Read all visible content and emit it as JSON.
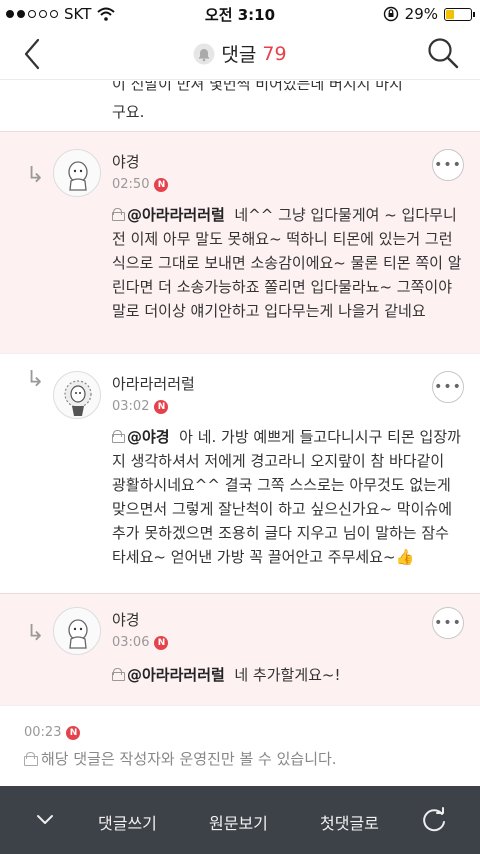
{
  "status_bar": {
    "carrier": "SKT",
    "time": "오전 3:10",
    "battery": "29%",
    "battery_level": 0.29
  },
  "nav": {
    "title": "댓글",
    "count": "79"
  },
  "previous_tail": {
    "line1": "이 신발이 만져 몇번씩 비어있는데 버지지 마지",
    "line2": "구요."
  },
  "comments": [
    {
      "nickname": "야경",
      "time": "02:50",
      "badge": "N",
      "mention": "@아라라러러럴",
      "text": "네^^ 그냥 입다물게여 ~ 입다무니 전 이제 아무 말도 못해요~ 떡하니 티몬에 있는거 그런식으로 그대로 보내면 소송감이에요~ 물론  티몬 쪽이 알린다면 더 소송가능하죠 쫄리면 입다물라뇨~ 그쪽이야 말로 더이상 얘기안하고 입다무는게 나을거 같네요"
    },
    {
      "nickname": "아라라러러럴",
      "time": "03:02",
      "badge": "N",
      "mention": "@야경",
      "text": "아 네. 가방 예쁘게 들고다니시구 티몬 입장까지 생각하셔서 저에게 경고라니 오지랖이 참 바다같이 광활하시네요^^ 결국 그쪽 스스로는 아무것도 없는게 맞으면서 그렇게 잘난척이 하고 싶으신가요~ 막이슈에 추가 못하겠으면 조용히 글다 지우고 님이 말하는 잠수타세요~ 얻어낸 가방 꼭 끌어안고 주무세요~👍"
    },
    {
      "nickname": "야경",
      "time": "03:06",
      "badge": "N",
      "mention": "@아라라러러럴",
      "text": "네 추가할게요~!"
    }
  ],
  "last_comment": {
    "time": "00:23",
    "badge": "N",
    "private_notice": "해당 댓글은 작성자와 운영진만 볼 수 있습니다."
  },
  "bottom_bar": {
    "write": "댓글쓰기",
    "original": "원문보기",
    "first": "첫댓글로"
  }
}
